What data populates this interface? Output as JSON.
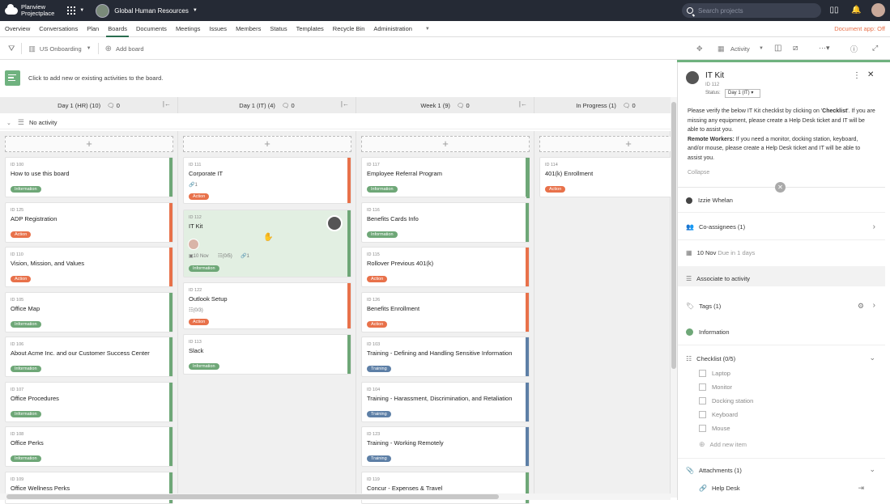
{
  "app": {
    "logo_line1": "Planview",
    "logo_line2": "Projectplace",
    "project": "Global Human Resources",
    "search_placeholder": "Search projects"
  },
  "menu": [
    "Overview",
    "Conversations",
    "Plan",
    "Boards",
    "Documents",
    "Meetings",
    "Issues",
    "Members",
    "Status",
    "Templates",
    "Recycle Bin",
    "Administration"
  ],
  "doc_app": "Document app: Off",
  "toolbar": {
    "board": "US Onboarding",
    "add_board": "Add board",
    "activity": "Activity"
  },
  "add_bar_text": "Click to add new or existing activities to the board.",
  "columns": [
    {
      "title": "Day 1 (HR)",
      "count": "(10)",
      "comments": "0"
    },
    {
      "title": "Day 1 (IT)",
      "count": "(4)",
      "comments": "0"
    },
    {
      "title": "Week 1",
      "count": "(9)",
      "comments": "0"
    },
    {
      "title": "In Progress",
      "count": "(1)",
      "comments": "0"
    }
  ],
  "no_activity": "No activity",
  "col1": [
    {
      "id": "ID 100",
      "title": "How to use this board",
      "tag": "Information"
    },
    {
      "id": "ID 125",
      "title": "ADP Registration",
      "tag": "Action"
    },
    {
      "id": "ID 110",
      "title": "Vision, Mission, and Values",
      "tag": "Action"
    },
    {
      "id": "ID 105",
      "title": "Office Map",
      "tag": "Information"
    },
    {
      "id": "ID 106",
      "title": "About Acme Inc. and our Customer Success Center",
      "tag": "Information"
    },
    {
      "id": "ID 107",
      "title": "Office Procedures",
      "tag": "Information"
    },
    {
      "id": "ID 108",
      "title": "Office Perks",
      "tag": "Information"
    },
    {
      "id": "ID 109",
      "title": "Office Wellness Perks",
      "tag": ""
    }
  ],
  "col2": [
    {
      "id": "ID 111",
      "title": "Corporate IT",
      "tag": "Action",
      "meta": "1"
    },
    {
      "id": "ID 112",
      "title": "IT Kit",
      "tag": "Information",
      "date": "10 Nov",
      "checklist": "(0/5)",
      "attach": "1"
    },
    {
      "id": "ID 122",
      "title": "Outlook Setup",
      "tag": "Action",
      "meta": "(0/3)"
    },
    {
      "id": "ID 113",
      "title": "Slack",
      "tag": "Information"
    }
  ],
  "col3": [
    {
      "id": "ID 117",
      "title": "Employee Referral Program",
      "tag": "Information"
    },
    {
      "id": "ID 116",
      "title": "Benefits Cards Info",
      "tag": "Information"
    },
    {
      "id": "ID 115",
      "title": "Rollover Previous 401(k)",
      "tag": "Action"
    },
    {
      "id": "ID 126",
      "title": "Benefits Enrollment",
      "tag": "Action"
    },
    {
      "id": "ID 103",
      "title": "Training - Defining and Handling Sensitive Information",
      "tag": "Training"
    },
    {
      "id": "ID 104",
      "title": "Training - Harassment, Discrimination, and Retaliation",
      "tag": "Training"
    },
    {
      "id": "ID 123",
      "title": "Training - Working Remotely",
      "tag": "Training"
    },
    {
      "id": "ID 119",
      "title": "Concur - Expenses & Travel",
      "tag": ""
    }
  ],
  "col4": [
    {
      "id": "ID 114",
      "title": "401(k) Enrollment",
      "tag": "Action"
    }
  ],
  "panel": {
    "title": "IT Kit",
    "id": "ID 112",
    "status_label": "Status:",
    "status_value": "Day 1 (IT)",
    "desc1a": "Please verify the below IT Kit checklist by clicking on '",
    "desc1b": "Checklist",
    "desc1c": "'. If you are missing any equipment, please create a Help Desk ticket and IT will be able to assist you.",
    "desc2a": "Remote Workers:",
    "desc2b": " If you need a monitor, docking station, keyboard, and/or mouse, please create a Help Desk ticket and IT will be able to assist you.",
    "collapse": "Collapse",
    "assignee": "Izzie Whelan",
    "coassignees": "Co-assignees (1)",
    "date": "10 Nov",
    "due": "Due in 1 days",
    "associate": "Associate to activity",
    "tags": "Tags (1)",
    "tag_value": "Information",
    "checklist": "Checklist (0/5)",
    "items": [
      "Laptop",
      "Monitor",
      "Docking station",
      "Keyboard",
      "Mouse"
    ],
    "add_item": "Add new item",
    "attachments": "Attachments (1)",
    "attachment": "Help Desk"
  }
}
